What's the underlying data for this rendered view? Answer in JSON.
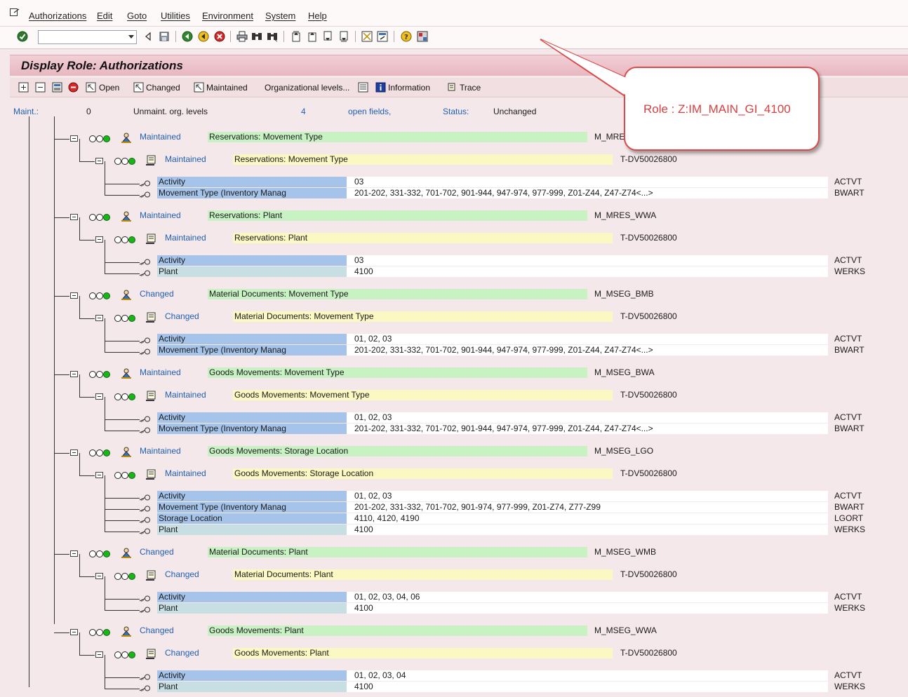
{
  "menu": [
    "Authorizations",
    "Edit",
    "Goto",
    "Utilities",
    "Environment",
    "System",
    "Help"
  ],
  "toolbar": {
    "command_field_value": "",
    "icons": [
      "enter-icon",
      "back-icon",
      "save-icon",
      "back-nav-icon",
      "exit-icon",
      "cancel-icon",
      "print-icon",
      "find-icon",
      "find-next-icon",
      "first-page-icon",
      "prev-page-icon",
      "next-page-icon",
      "last-page-icon",
      "create-session-icon",
      "shortcut-icon",
      "help-icon",
      "layout-icon"
    ]
  },
  "title": "Display Role: Authorizations",
  "app_toolbar": {
    "open": "Open",
    "changed": "Changed",
    "maintained": "Maintained",
    "org_levels": "Organizational levels...",
    "information": "Information",
    "trace": "Trace"
  },
  "status_line": {
    "maint_label": "Maint.:",
    "maint_value": "0",
    "unmaint_label": "Unmaint. org. levels",
    "open_count": "4",
    "open_label": "open fields,",
    "status_label": "Status:",
    "status_value": "Unchanged"
  },
  "callout": "Role : Z:IM_MAIN_GI_4100",
  "colors": {
    "green_bar": "#c8f1c4",
    "yellow_bar": "#fbf8c3",
    "blue_bar": "#a6c4ea",
    "title_bar": "#e7b7c0",
    "link_blue": "#1f5fb4",
    "callout_red": "#d94b4b"
  },
  "objects": [
    {
      "status": "Maintained",
      "text": "Reservations: Movement Type",
      "code": "M_MRES_BWA",
      "auth": {
        "status": "Maintained",
        "text": "Reservations: Movement Type",
        "code": "T-DV50026800"
      },
      "fields": [
        {
          "name": "Activity",
          "value": "03",
          "key": "ACTVT"
        },
        {
          "name": "Movement Type (Inventory Manag",
          "value": "201-202, 331-332, 701-702, 901-944, 947-974, 977-999, Z01-Z44, Z47-Z74<...>",
          "key": "BWART"
        }
      ]
    },
    {
      "status": "Maintained",
      "text": "Reservations: Plant",
      "code": "M_MRES_WWA",
      "auth": {
        "status": "Maintained",
        "text": "Reservations: Plant",
        "code": "T-DV50026800"
      },
      "fields": [
        {
          "name": "Activity",
          "value": "03",
          "key": "ACTVT"
        },
        {
          "name": "Plant",
          "value": "4100",
          "key": "WERKS"
        }
      ]
    },
    {
      "status": "Changed",
      "text": "Material Documents: Movement Type",
      "code": "M_MSEG_BMB",
      "auth": {
        "status": "Changed",
        "text": "Material Documents: Movement Type",
        "code": "T-DV50026800"
      },
      "fields": [
        {
          "name": "Activity",
          "value": "01, 02, 03",
          "key": "ACTVT"
        },
        {
          "name": "Movement Type (Inventory Manag",
          "value": "201-202, 331-332, 701-702, 901-944, 947-974, 977-999, Z01-Z44, Z47-Z74<...>",
          "key": "BWART"
        }
      ]
    },
    {
      "status": "Maintained",
      "text": "Goods Movements: Movement Type",
      "code": "M_MSEG_BWA",
      "auth": {
        "status": "Maintained",
        "text": "Goods Movements: Movement Type",
        "code": "T-DV50026800"
      },
      "fields": [
        {
          "name": "Activity",
          "value": "01, 02, 03",
          "key": "ACTVT"
        },
        {
          "name": "Movement Type (Inventory Manag",
          "value": "201-202, 331-332, 701-702, 901-944, 947-974, 977-999, Z01-Z44, Z47-Z74<...>",
          "key": "BWART"
        }
      ]
    },
    {
      "status": "Maintained",
      "text": "Goods Movements: Storage Location",
      "code": "M_MSEG_LGO",
      "auth": {
        "status": "Maintained",
        "text": "Goods Movements: Storage Location",
        "code": "T-DV50026800"
      },
      "fields": [
        {
          "name": "Activity",
          "value": "01, 02, 03",
          "key": "ACTVT"
        },
        {
          "name": "Movement Type (Inventory Manag",
          "value": "201-202, 331-332, 701-702, 901-974, 977-999, Z01-Z74, Z77-Z99",
          "key": "BWART"
        },
        {
          "name": "Storage Location",
          "value": "4110, 4120, 4190",
          "key": "LGORT"
        },
        {
          "name": "Plant",
          "value": "4100",
          "key": "WERKS"
        }
      ]
    },
    {
      "status": "Changed",
      "text": "Material Documents: Plant",
      "code": "M_MSEG_WMB",
      "auth": {
        "status": "Changed",
        "text": "Material Documents: Plant",
        "code": "T-DV50026800"
      },
      "fields": [
        {
          "name": "Activity",
          "value": "01, 02, 03, 04, 06",
          "key": "ACTVT"
        },
        {
          "name": "Plant",
          "value": "4100",
          "key": "WERKS"
        }
      ]
    },
    {
      "status": "Changed",
      "text": "Goods Movements: Plant",
      "code": "M_MSEG_WWA",
      "auth": {
        "status": "Changed",
        "text": "Goods Movements: Plant",
        "code": "T-DV50026800"
      },
      "fields": [
        {
          "name": "Activity",
          "value": "01, 02, 03, 04",
          "key": "ACTVT"
        },
        {
          "name": "Plant",
          "value": "4100",
          "key": "WERKS"
        }
      ]
    }
  ]
}
